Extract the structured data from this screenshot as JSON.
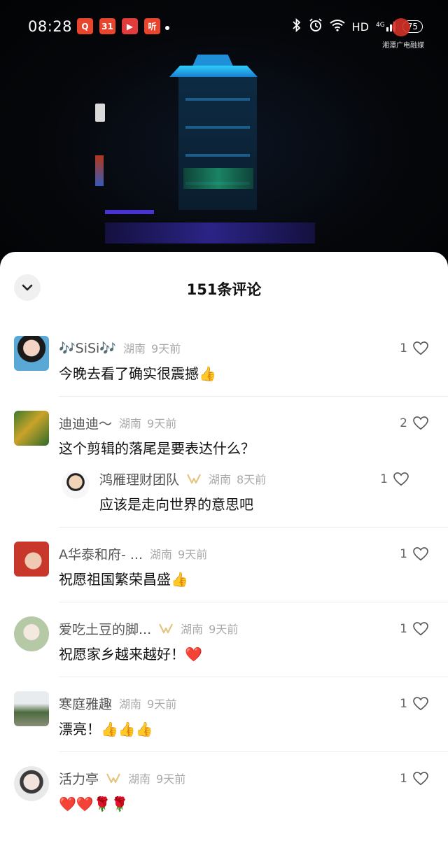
{
  "status_bar": {
    "time": "08:28",
    "app_icons": [
      {
        "name": "app-icon-1",
        "glyph": "Q",
        "color": "#e8452c"
      },
      {
        "name": "app-icon-2",
        "glyph": "31",
        "color": "#e8452c"
      },
      {
        "name": "app-icon-3",
        "glyph": "▶",
        "color": "#e23b3b"
      },
      {
        "name": "app-icon-4",
        "glyph": "听",
        "color": "#e8452c"
      }
    ],
    "network": "HD",
    "signal": "4G",
    "battery": "75",
    "watermark": "湘潭广电融媒"
  },
  "comments_panel": {
    "title": "151条评论",
    "comments": [
      {
        "name": "🎶SiSi🎶",
        "location": "湖南",
        "ago": "9天前",
        "text": "今晚去看了确实很震撼👍",
        "likes": "1",
        "vip": false
      },
      {
        "name": "迪迪迪～",
        "location": "湖南",
        "ago": "9天前",
        "text": "这个剪辑的落尾是要表达什么？",
        "likes": "2",
        "vip": false,
        "reply": {
          "name": "鸿雁理财团队",
          "location": "湖南",
          "ago": "8天前",
          "text": "应该是走向世界的意思吧",
          "likes": "1",
          "vip": true
        }
      },
      {
        "name": "A华泰和府- ...",
        "location": "湖南",
        "ago": "9天前",
        "text": "祝愿祖国繁荣昌盛👍",
        "likes": "1",
        "vip": false
      },
      {
        "name": "爱吃土豆的脚...",
        "location": "湖南",
        "ago": "9天前",
        "text": "祝愿家乡越来越好！❤️",
        "likes": "1",
        "vip": true
      },
      {
        "name": "寒庭雅趣",
        "location": "湖南",
        "ago": "9天前",
        "text": "漂亮！👍👍👍",
        "likes": "1",
        "vip": false
      },
      {
        "name": "活力亭",
        "location": "湖南",
        "ago": "9天前",
        "text": "❤️❤️🌹🌹",
        "likes": "1",
        "vip": true
      }
    ]
  },
  "colors": {
    "accent_vip": "#e3c27a",
    "like_icon": "#555555",
    "sheet_bg": "#ffffff"
  }
}
